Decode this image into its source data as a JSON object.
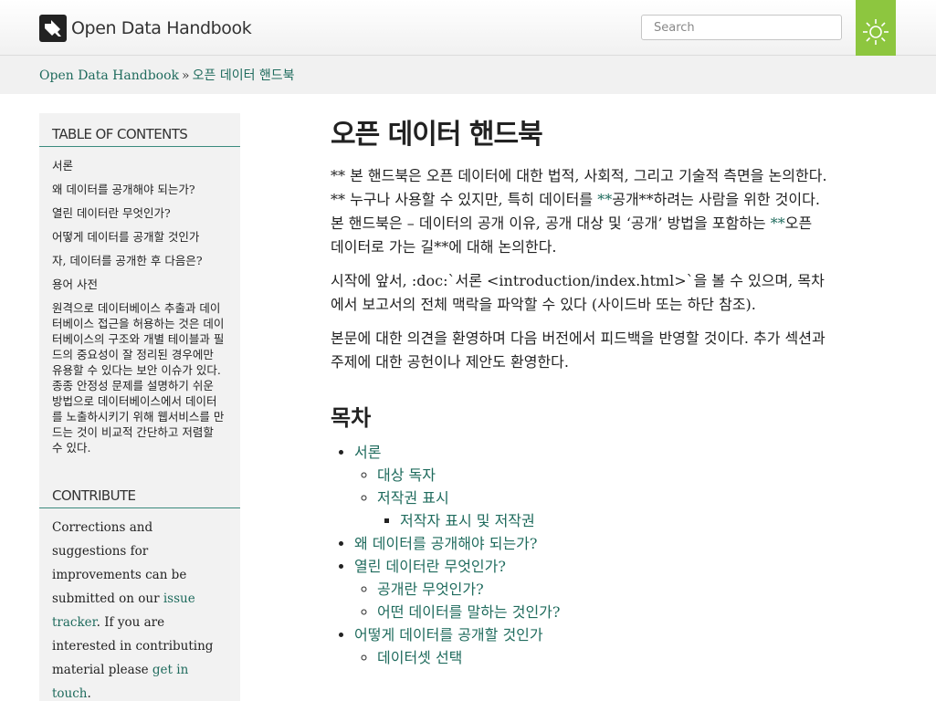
{
  "header": {
    "site_title": "Open Data Handbook",
    "search_placeholder": "Search"
  },
  "breadcrumb": {
    "home": "Open Data Handbook",
    "separator": "»",
    "current": "오픈 데이터 핸드북"
  },
  "sidebar": {
    "toc_heading": "TABLE OF CONTENTS",
    "toc_items": [
      "서론",
      "왜 데이터를 공개해야 되는가?",
      "열린 데이터란 무엇인가?",
      "어떻게 데이터를 공개할 것인가",
      "자, 데이터를 공개한 후 다음은?",
      "용어 사전",
      "원격으로 데이터베이스 추출과 데이터베이스 접근을 허용하는 것은 데이터베이스의 구조와 개별 테이블과 필드의 중요성이 잘 정리된 경우에만 유용할 수 있다는 보안 이슈가 있다. 종종 안정성 문제를 설명하기 쉬운 방법으로 데이터베이스에서 데이터를 노출하시키기 위해 웹서비스를 만드는 것이 비교적 간단하고 저렴할 수 있다."
    ],
    "contribute_heading": "CONTRIBUTE",
    "contribute_text_1": "Corrections and suggestions for improvements can be submitted on our ",
    "contribute_link_1": "issue tracker",
    "contribute_text_2": ". If you are interested in contributing material please ",
    "contribute_link_2": "get in touch",
    "contribute_text_3": "."
  },
  "main": {
    "title": "오픈 데이터 핸드북",
    "para1_a": "** 본 핸드북은 오픈 데이터에 대한 법적, 사회적, 그리고 기술적 측면을 논의한다. ** 누구나 사용할 수 있지만, 특히 데이터를 ",
    "para1_b": "**",
    "para1_c": "공개**하려는 사람을 위한 것이다. 본 핸드북은 – 데이터의 공개 이유, 공개 대상 및 ‘공개’ 방법을 포함하는 ",
    "para1_d": "**",
    "para1_e": "오픈 데이터로 가는 길**에 대해 논의한다.",
    "para2": "시작에 앞서, :doc:`서론 <introduction/index.html>`을 볼 수 있으며, 목차에서 보고서의 전체 맥락을 파악할 수 있다 (사이드바 또는 하단 참조).",
    "para3": "본문에 대한 의견을 환영하며 다음 버전에서 피드백을 반영할 것이다. 추가 섹션과 주제에 대한 공헌이나 제안도 환영한다.",
    "toc_title": "목차",
    "toc": {
      "intro": "서론",
      "intro_audience": "대상 독자",
      "intro_copyright": "저작권 표시",
      "intro_copyright_attr": "저작자 표시 및 저작권",
      "why": "왜 데이터를 공개해야 되는가?",
      "what": "열린 데이터란 무엇인가?",
      "what_open": "공개란 무엇인가?",
      "what_data": "어떤 데이터를 말하는 것인가?",
      "how": "어떻게 데이터를 공개할 것인가",
      "how_choose": "데이터셋 선택"
    }
  },
  "colors": {
    "link": "#1f6b5d",
    "ribbon": "#8dc63f",
    "sidebar_bg": "#f2f2f2"
  }
}
